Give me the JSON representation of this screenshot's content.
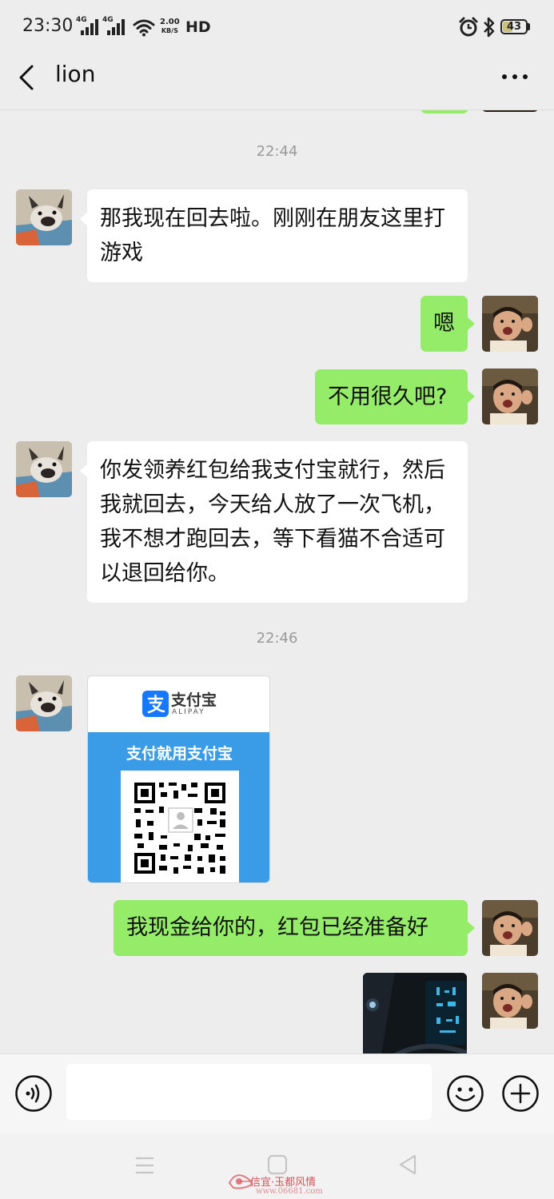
{
  "status_bar": {
    "time": "23:30",
    "signal_label_1": "4G",
    "signal_label_2": "4G",
    "speed_value": "2.00",
    "speed_unit": "KB/S",
    "hd_label": "HD",
    "battery_level": "43",
    "battery_fraction": 0.43
  },
  "header": {
    "title": "lion"
  },
  "messages": [
    {
      "type": "time",
      "text": "22:44"
    },
    {
      "type": "text",
      "from": "other",
      "text": "那我现在回去啦。刚刚在朋友这里打游戏"
    },
    {
      "type": "text",
      "from": "me",
      "text": "嗯"
    },
    {
      "type": "text",
      "from": "me",
      "text": "不用很久吧?"
    },
    {
      "type": "text",
      "from": "other",
      "text": "你发领养红包给我支付宝就行，然后我就回去，今天给人放了一次飞机，我不想才跑回去，等下看猫不合适可以退回给你。"
    },
    {
      "type": "time",
      "text": "22:46"
    },
    {
      "type": "image",
      "from": "other",
      "alipay_logo": "支付宝",
      "alipay_logo_en": "ALIPAY",
      "alipay_slogan": "支付就用支付宝"
    },
    {
      "type": "text",
      "from": "me",
      "text": "我现金给你的，红包已经准备好"
    },
    {
      "type": "image",
      "from": "me"
    }
  ],
  "input": {
    "placeholder": ""
  },
  "watermark": {
    "text": "一信宜·玉都风情",
    "url": "www.06681.com"
  },
  "colors": {
    "background": "#ededed",
    "outgoing_bubble": "#95ec69",
    "incoming_bubble": "#ffffff",
    "alipay_blue": "#1677ff"
  }
}
